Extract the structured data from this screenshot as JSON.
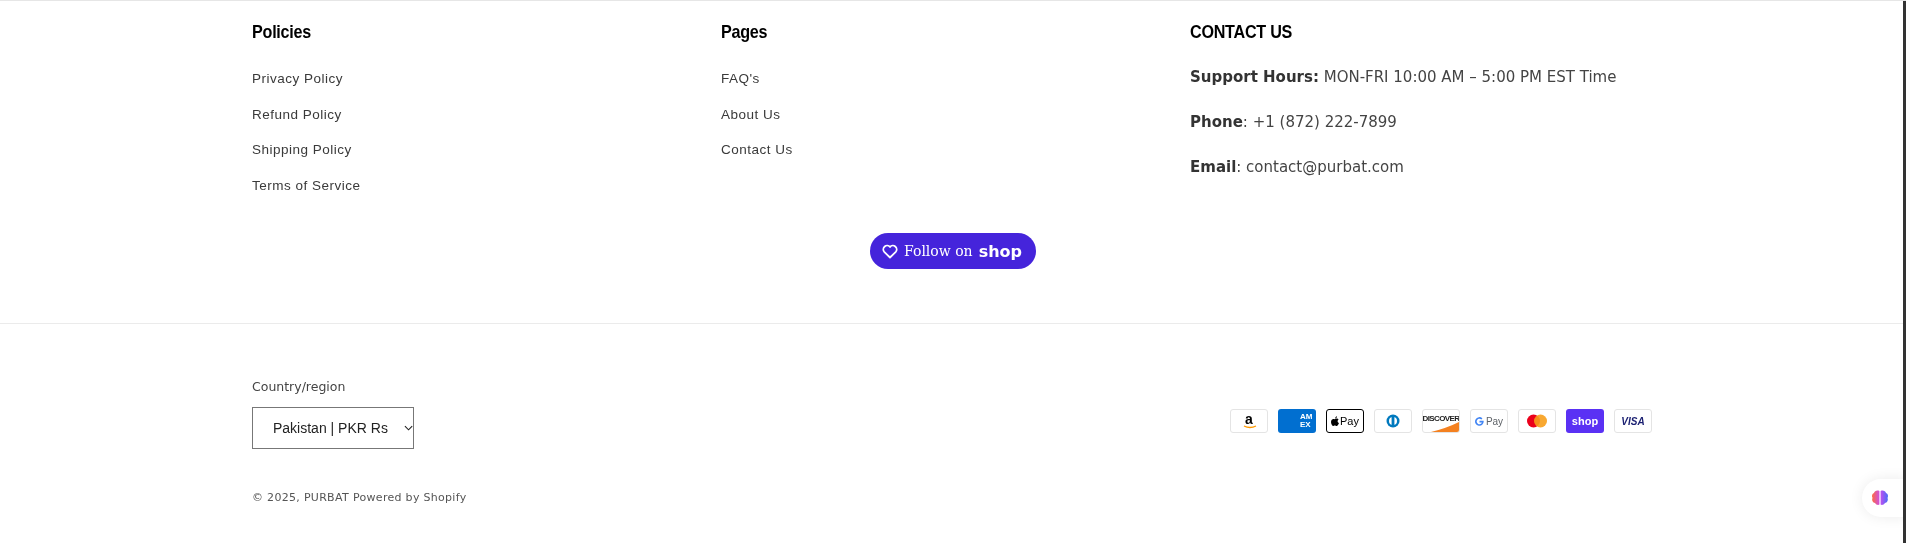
{
  "columns": [
    {
      "heading": "Policies",
      "links": [
        "Privacy Policy",
        "Refund Policy",
        "Shipping Policy",
        "Terms of Service"
      ]
    },
    {
      "heading": "Pages",
      "links": [
        "FAQ's",
        "About Us",
        "Contact Us"
      ]
    }
  ],
  "contact": {
    "heading": "CONTACT US",
    "lines": [
      "**Support Hours:** MON-FRI 10:00 AM – 5:00 PM EST Time",
      "**Phone**: +1 (872) 222-7899",
      "**Email**: contact@purbat.com"
    ]
  },
  "follow_button": {
    "label": "Follow on",
    "brand": "shop"
  },
  "country": {
    "label": "Country/region",
    "value": "Pakistan | PKR Rs"
  },
  "copyright": {
    "text": "© 2025, PURBAT",
    "powered": "Powered by Shopify"
  },
  "payment_icons": [
    {
      "kind": "amazon",
      "text": "a"
    },
    {
      "kind": "amex",
      "text": "AM EX"
    },
    {
      "kind": "applepay",
      "text": "Pay"
    },
    {
      "kind": "diners"
    },
    {
      "kind": "discover",
      "text": "DISCOVER"
    },
    {
      "kind": "gpay",
      "text": "Pay"
    },
    {
      "kind": "mastercard"
    },
    {
      "kind": "shoppay",
      "text": "shop"
    },
    {
      "kind": "visa",
      "text": "VISA"
    }
  ]
}
